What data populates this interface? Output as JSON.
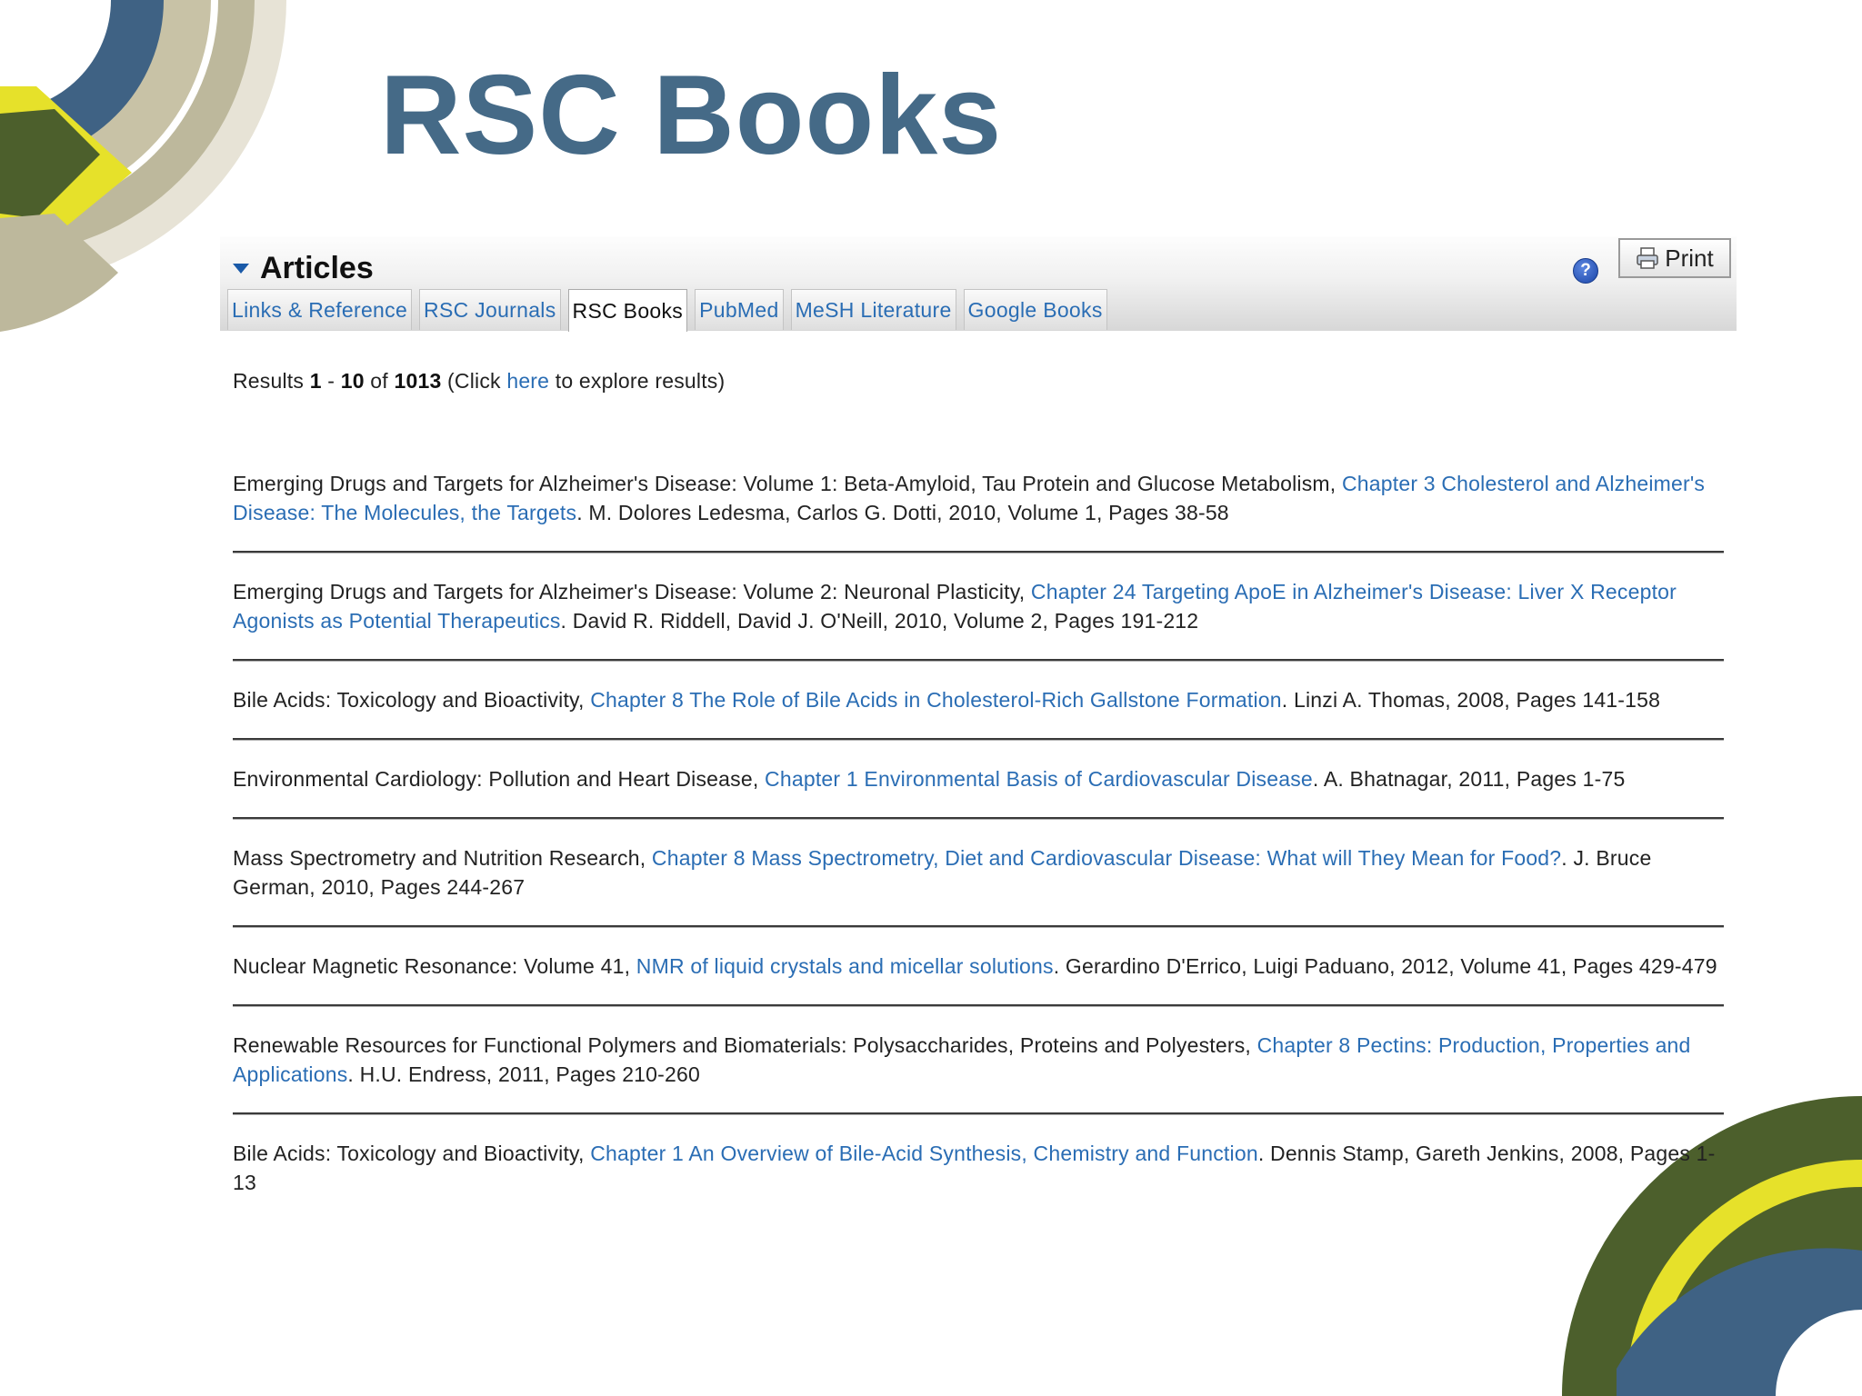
{
  "slide": {
    "title": "RSC Books"
  },
  "panel": {
    "title": "Articles",
    "help_label": "?",
    "print_label": "Print",
    "tabs": [
      {
        "label": "Links & Reference",
        "active": false
      },
      {
        "label": "RSC Journals",
        "active": false
      },
      {
        "label": "RSC Books",
        "active": true
      },
      {
        "label": "PubMed",
        "active": false
      },
      {
        "label": "MeSH Literature",
        "active": false
      },
      {
        "label": "Google Books",
        "active": false
      }
    ]
  },
  "results_summary": {
    "prefix": "Results ",
    "from": "1",
    "dash": " - ",
    "to": "10",
    "of": " of ",
    "total": "1013",
    "click_text": " (Click ",
    "here_link": "here",
    "suffix": " to explore results)"
  },
  "results": [
    {
      "book": "Emerging Drugs and Targets for Alzheimer's Disease: Volume 1: Beta-Amyloid, Tau Protein and Glucose Metabolism, ",
      "chapter": "Chapter 3 Cholesterol and Alzheimer's Disease: The Molecules, the Targets",
      "details": ". M. Dolores Ledesma, Carlos G. Dotti, 2010, Volume 1, Pages 38-58"
    },
    {
      "book": "Emerging Drugs and Targets for Alzheimer's Disease: Volume 2: Neuronal Plasticity, ",
      "chapter": "Chapter 24 Targeting ApoE in Alzheimer's Disease: Liver X Receptor Agonists as Potential Therapeutics",
      "details": ". David R. Riddell, David J. O'Neill, 2010, Volume 2, Pages 191-212"
    },
    {
      "book": "Bile Acids: Toxicology and Bioactivity, ",
      "chapter": "Chapter 8 The Role of Bile Acids in Cholesterol-Rich Gallstone Formation",
      "details": ". Linzi A. Thomas, 2008, Pages 141-158"
    },
    {
      "book": "Environmental Cardiology: Pollution and Heart Disease, ",
      "chapter": "Chapter 1 Environmental Basis of Cardiovascular Disease",
      "details": ". A. Bhatnagar, 2011, Pages 1-75"
    },
    {
      "book": "Mass Spectrometry and Nutrition Research, ",
      "chapter": "Chapter 8 Mass Spectrometry, Diet and Cardiovascular Disease: What will They Mean for Food?",
      "details": ". J. Bruce German, 2010, Pages 244-267"
    },
    {
      "book": "Nuclear Magnetic Resonance: Volume 41, ",
      "chapter": "NMR of liquid crystals and micellar solutions",
      "details": ". Gerardino D'Errico, Luigi Paduano, 2012, Volume 41, Pages 429-479"
    },
    {
      "book": "Renewable Resources for Functional Polymers and Biomaterials: Polysaccharides, Proteins and Polyesters, ",
      "chapter": "Chapter 8 Pectins: Production, Properties and Applications",
      "details": ". H.U. Endress, 2011, Pages 210-260"
    },
    {
      "book": "Bile Acids: Toxicology and Bioactivity, ",
      "chapter": "Chapter 1 An Overview of Bile-Acid Synthesis, Chemistry and Function",
      "details": ". Dennis Stamp, Gareth Jenkins, 2008, Pages 1-13"
    }
  ],
  "colors": {
    "title": "#456a87",
    "link": "#2a6db4",
    "deco_blue": "#3f6284",
    "deco_green": "#4c5f2c",
    "deco_yellow": "#e6e12a",
    "deco_tan": "#bdb89c"
  }
}
